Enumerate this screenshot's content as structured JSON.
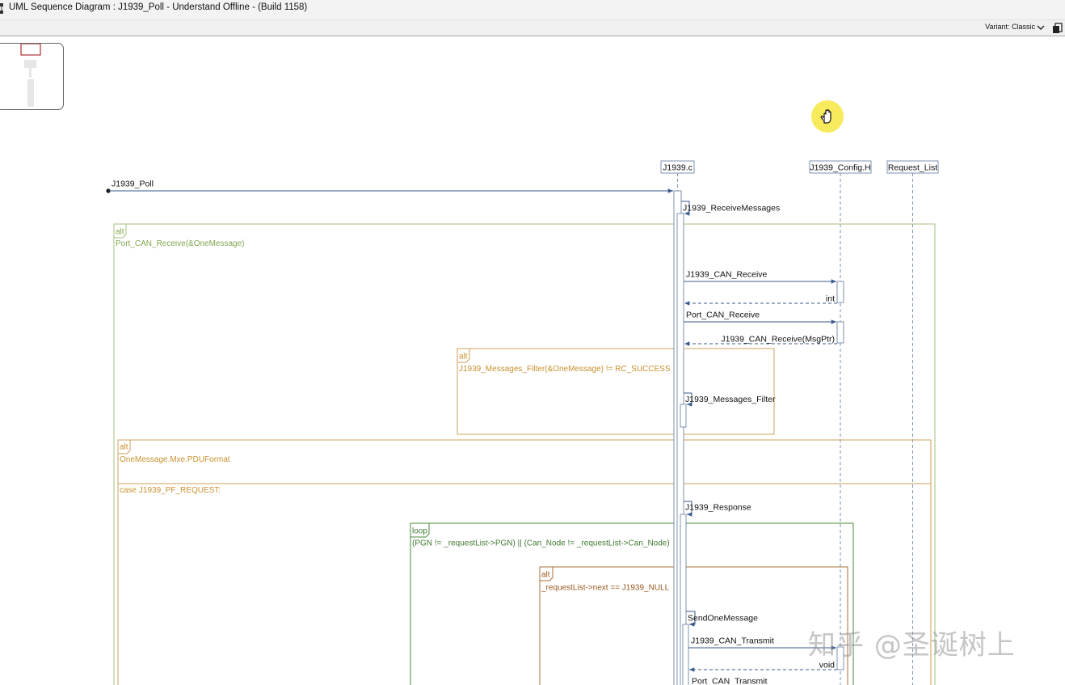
{
  "window": {
    "title": "UML Sequence Diagram : J1939_Poll - Understand Offline - (Build 1158)"
  },
  "toolbar": {
    "variant_label": "Variant: Classic"
  },
  "icons": {
    "app": "app-icon",
    "dropdown": "chevron-down-icon",
    "copy": "copy-icon",
    "cursor": "hand-cursor-icon"
  },
  "colors": {
    "lifeline": "#7d93b2",
    "message": "#3b5a8e",
    "alt_frame": "#a5c27c",
    "alt_frame_text": "#7fa64e",
    "alt_frame_orange": "#cfa05e",
    "alt_frame_orange_text": "#c8902f",
    "loop_frame": "#4a8a3a",
    "inner_alt_frame": "#a9703a",
    "inner_alt_text": "#9a5a1f",
    "highlight": "#f6e84a"
  },
  "lifelines": [
    {
      "name": "J1939.c"
    },
    {
      "name": "J1939_Config.H"
    },
    {
      "name": "Request_List"
    }
  ],
  "messages": {
    "entry": "J1939_Poll",
    "receive_messages": "J1939_ReceiveMessages",
    "can_receive": "J1939_CAN_Receive",
    "ret_int": "int",
    "port_can_receive": "Port_CAN_Receive",
    "ret_can_receive": "J1939_CAN_Receive(MsgPtr)",
    "messages_filter": "J1939_Messages_Filter",
    "response": "J1939_Response",
    "send_one": "SendOneMessage",
    "can_transmit": "J1939_CAN_Transmit",
    "ret_void": "void",
    "port_can_transmit": "Port_CAN_Transmit"
  },
  "fragments": {
    "alt1": {
      "kw": "alt",
      "guard": "Port_CAN_Receive(&OneMessage)"
    },
    "alt2": {
      "kw": "alt",
      "guard": "J1939_Messages_Filter(&OneMessage) != RC_SUCCESS"
    },
    "alt3": {
      "kw": "alt",
      "guard": "OneMessage.Mxe.PDUFormat",
      "case": "case J1939_PF_REQUEST:"
    },
    "loop": {
      "kw": "loop",
      "guard": "(PGN != _requestList->PGN) || (Can_Node != _requestList->Can_Node)"
    },
    "alt4": {
      "kw": "alt",
      "guard": "_requestList->next == J1939_NULL"
    }
  },
  "watermark": "知乎 @圣诞树上"
}
